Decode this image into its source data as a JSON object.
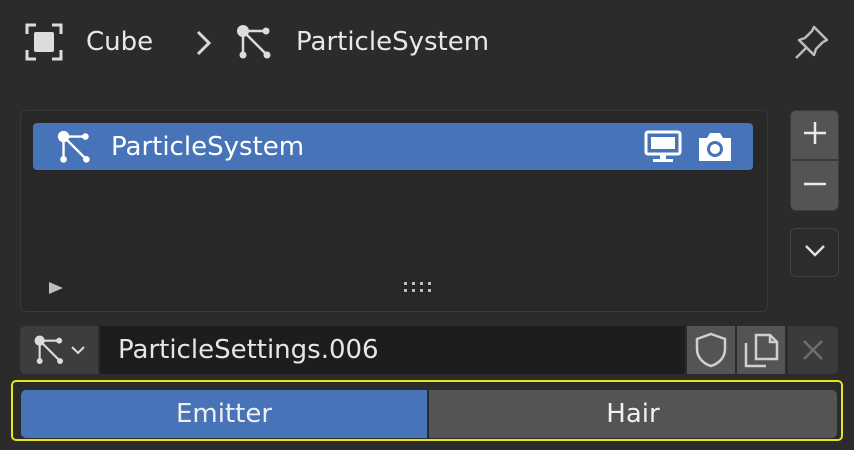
{
  "breadcrumb": {
    "object_icon": "object-data-icon",
    "object_label": "Cube",
    "separator_icon": "chevron-right-icon",
    "particles_icon": "particles-icon",
    "system_label": "ParticleSystem",
    "pin_icon": "pin-icon"
  },
  "particle_list": {
    "items": [
      {
        "label": "ParticleSystem",
        "icon": "particles-icon",
        "viewport_icon": "monitor-icon",
        "render_icon": "camera-icon",
        "selected": true
      }
    ],
    "expand_icon": "play-right-icon",
    "grip_icon": "drag-grip-icon"
  },
  "list_side_buttons": {
    "add_icon": "plus-icon",
    "remove_icon": "minus-icon",
    "menu_icon": "chevron-down-icon"
  },
  "settings_datablock": {
    "type_icon": "particles-icon",
    "name": "ParticleSettings.006",
    "fake_user_icon": "shield-icon",
    "duplicate_icon": "duplicate-icon",
    "unlink_icon": "close-icon"
  },
  "type_tabs": {
    "items": [
      "Emitter",
      "Hair"
    ],
    "selected": "Emitter"
  },
  "colors": {
    "accent": "#4773b9",
    "highlight": "#e8e31a"
  }
}
